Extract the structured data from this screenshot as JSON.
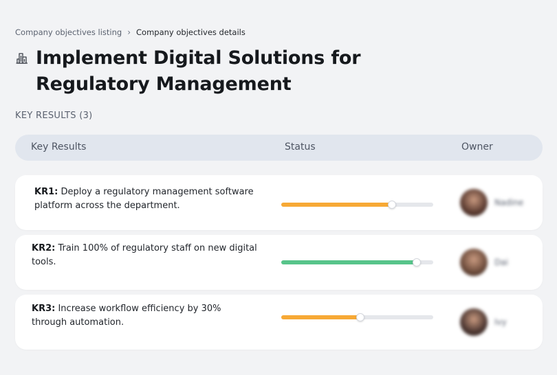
{
  "breadcrumb": {
    "parent": "Company objectives listing",
    "separator": "›",
    "current": "Company objectives details"
  },
  "objective": {
    "icon": "building-icon",
    "title": "Implement Digital Solutions for Regulatory Management"
  },
  "key_results_section": {
    "label": "KEY RESULTS (3)"
  },
  "table": {
    "headers": {
      "key_results": "Key Results",
      "status": "Status",
      "owner": "Owner"
    },
    "rows": [
      {
        "code": "KR1:",
        "text": "Deploy a regulatory management software platform across the department.",
        "progress": 0.73,
        "status_color": "#f7a935",
        "owner_name": "Nadine",
        "avatar_color": "#5a3a30"
      },
      {
        "code": "KR2:",
        "text": "Train 100% of regulatory staff on new digital tools.",
        "progress": 0.89,
        "status_color": "#57c48a",
        "owner_name": "Dai",
        "avatar_color": "#6b4a3a"
      },
      {
        "code": "KR3:",
        "text": "Increase workflow efficiency by 30% through automation.",
        "progress": 0.52,
        "status_color": "#f7a935",
        "owner_name": "Ivy",
        "avatar_color": "#4a3530"
      }
    ]
  }
}
